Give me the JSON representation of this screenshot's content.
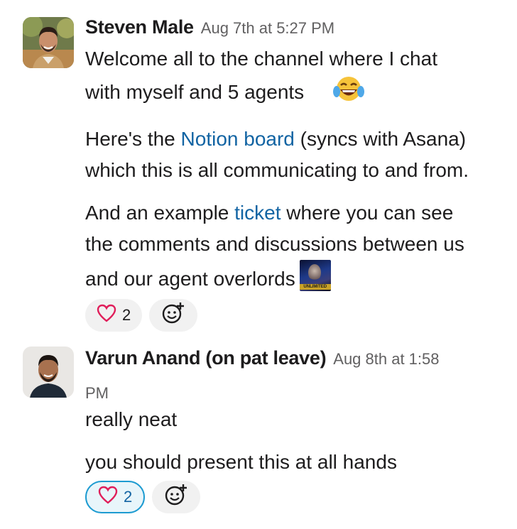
{
  "messages": [
    {
      "author": "Steven Male",
      "timestamp": "Aug 7th at 5:27 PM",
      "line1": "Welcome all to the channel where I chat",
      "line2": "with myself and 5 agents",
      "emoji": "joy-emoji",
      "p2_pre": "Here's the ",
      "p2_link": "Notion board",
      "p2_post": " (syncs with Asana)",
      "p2_line2": "which this is all communicating to and from.",
      "p3_pre": "And an example ",
      "p3_link": "ticket",
      "p3_post": " where you can see",
      "p3_line2": "the comments and discussions between us",
      "p3_line3": "and our agent overlords",
      "custom_emoji_text": "UNLIMITED",
      "reaction": {
        "emoji": "heart",
        "count": "2"
      }
    },
    {
      "author": "Varun Anand (on pat leave)",
      "timestamp_part1": "Aug 8th at 1:58",
      "timestamp_part2": "PM",
      "p1": "really neat",
      "p2": "you should present this at all hands",
      "reaction": {
        "emoji": "heart",
        "count": "2"
      }
    }
  ],
  "colors": {
    "link": "#1264a3",
    "heart": "#e01e5a",
    "active_reaction_border": "#1d9bd1"
  }
}
